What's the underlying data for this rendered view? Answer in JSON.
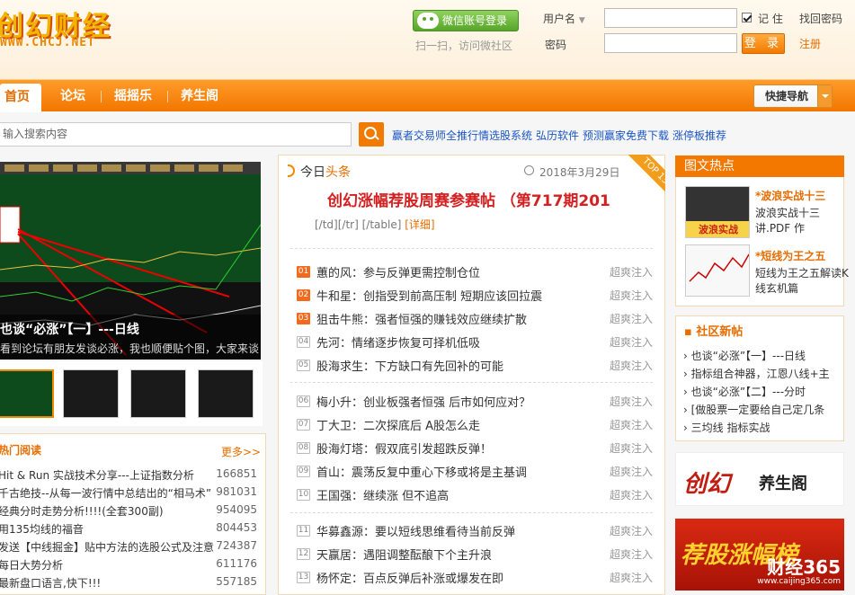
{
  "header": {
    "logo_text": "创幻财经",
    "logo_url": "WWW.CHCJ.NET",
    "wechat_login": "微信账号登录",
    "wechat_sub": "扫一扫，访问微社区",
    "username_label": "用户名",
    "password_label": "密码",
    "remember": "记 住",
    "forgot": "找回密码",
    "login": "登 录",
    "register": "注册"
  },
  "nav": {
    "home": "首页",
    "forum": "论坛",
    "shake": "摇摇乐",
    "health": "养生阁",
    "quick_nav": "快捷导航"
  },
  "search": {
    "placeholder": "输入搜索内容"
  },
  "promo": [
    "赢者交易师全推行情选股系统",
    "弘历软件",
    "预测赢家免费下载",
    "涨停板推荐"
  ],
  "slider": {
    "caption_title": "也谈“必涨”【一】---日线",
    "caption_sub": "看到论坛有朋友发谈必涨，我也顺便贴个图，大家来谈"
  },
  "hot": {
    "title": "热门阅读",
    "more": "更多>>",
    "items": [
      {
        "title": "Hit & Run 实战技术分享---上证指数分析",
        "views": "166851"
      },
      {
        "title": "千古绝技--从每一波行情中总结出的“相马术”",
        "views": "981031"
      },
      {
        "title": "经典分时走势分析!!!!(全套300副)",
        "views": "954095"
      },
      {
        "title": "用135均线的福音",
        "views": "804453"
      },
      {
        "title": "发送【中线掘金】贴中方法的选股公式及注意",
        "views": "724387"
      },
      {
        "title": "每日大势分析",
        "views": "611176"
      },
      {
        "title": "最新盘口语言,快下!!!",
        "views": "557185"
      }
    ]
  },
  "main": {
    "today_a": "今日",
    "today_b": "头条",
    "date": "2018年3月29日",
    "ribbon": "TOP 13",
    "headline": "创幻涨幅荐股周赛参赛帖 （第717期201",
    "tags": "[/td][/tr] [/table]",
    "detail": "[详细]",
    "articles": [
      {
        "rank": "01",
        "author": "蕙的风",
        "title": "参与反弹更需控制仓位",
        "user": "超爽注入"
      },
      {
        "rank": "02",
        "author": "牛和星",
        "title": "创指受到前高压制 短期应该回拉震",
        "user": "超爽注入"
      },
      {
        "rank": "03",
        "author": "狙击牛熊",
        "title": "强者恒强的赚钱效应继续扩散",
        "user": "超爽注入"
      },
      {
        "rank": "04",
        "author": "先河",
        "title": "情绪逐步恢复可择机低吸",
        "user": "超爽注入"
      },
      {
        "rank": "05",
        "author": "股海求生",
        "title": "下方缺口有先回补的可能",
        "user": "超爽注入"
      },
      {
        "rank": "06",
        "author": "梅小升",
        "title": "创业板强者恒强 后市如何应对？",
        "user": "超爽注入"
      },
      {
        "rank": "07",
        "author": "丁大卫",
        "title": "二次探底后 A股怎么走",
        "user": "超爽注入"
      },
      {
        "rank": "08",
        "author": "股海灯塔",
        "title": "假双底引发超跌反弹！",
        "user": "超爽注入"
      },
      {
        "rank": "09",
        "author": "首山",
        "title": "震荡反复中重心下移或将是主基调",
        "user": "超爽注入"
      },
      {
        "rank": "10",
        "author": "王国强",
        "title": "继续涨 但不追高",
        "user": "超爽注入"
      },
      {
        "rank": "11",
        "author": "华募鑫源",
        "title": "要以短线思维看待当前反弹",
        "user": "超爽注入"
      },
      {
        "rank": "12",
        "author": "天赢居",
        "title": "遇阻调整酝酿下个主升浪",
        "user": "超爽注入"
      },
      {
        "rank": "13",
        "author": "杨怀定",
        "title": "百点反弹后补涨或爆发在即",
        "user": "超爽注入"
      }
    ]
  },
  "sidebar": {
    "photo_title": "图文热点",
    "items": [
      {
        "title": "*波浪实战十三",
        "desc": "波浪实战十三讲.PDF 作",
        "img_label": "波浪实战"
      },
      {
        "title": "*短线为王之五",
        "desc": "短线为王之五解读K线玄机篇"
      }
    ],
    "community_title": "社区新帖",
    "community": [
      "也谈“必涨”【一】---日线",
      "指标组合神器，江恩八线+主",
      "也谈“必涨”【二】---分时",
      "[做股票一定要给自己定几条",
      "三均线 指标实战"
    ],
    "ad1_text": "养生阁",
    "ad1_logo": "创幻",
    "ad2_text": "荐股涨幅榜",
    "ad2_brand": "财经365",
    "ad2_url": "www.caijing365.com"
  },
  "colors": {
    "accent": "#f27800",
    "headline": "#d42020",
    "link": "#1a56c6"
  }
}
